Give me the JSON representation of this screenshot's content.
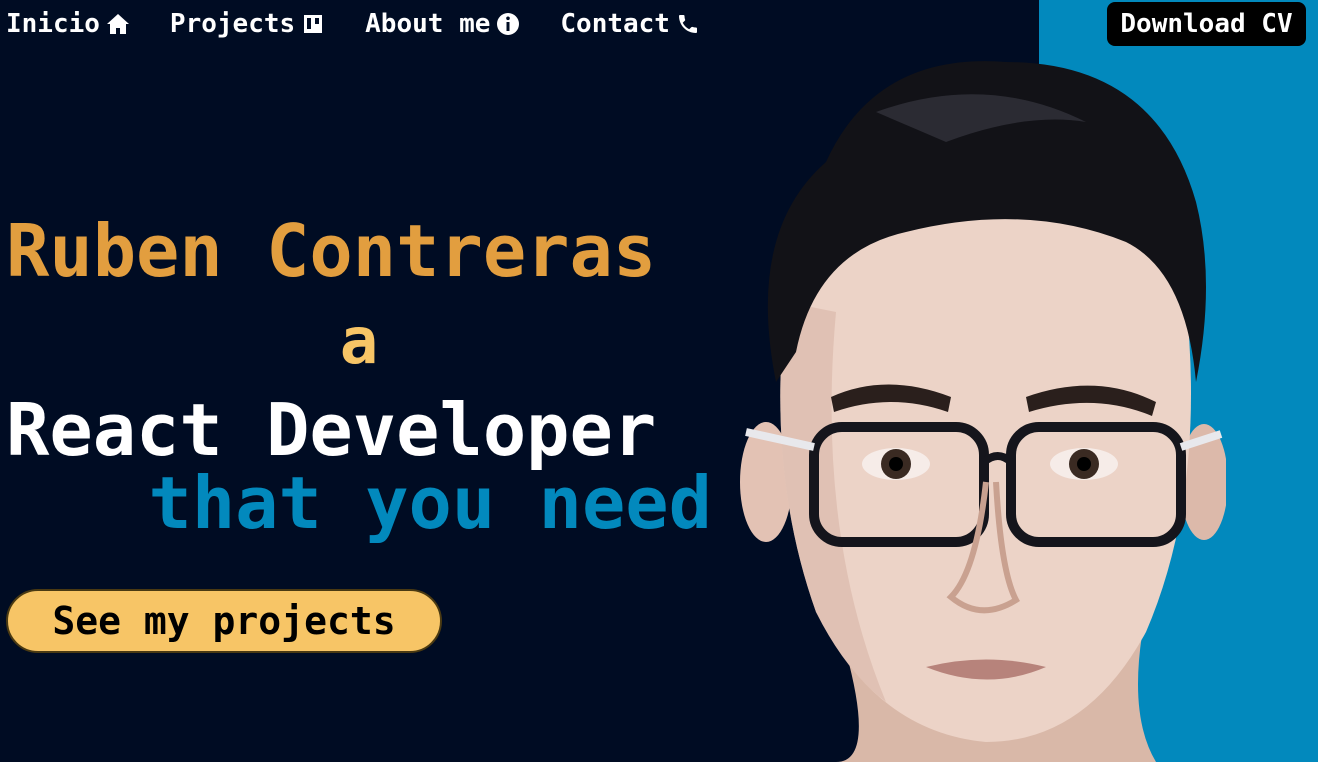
{
  "nav": {
    "items": [
      {
        "label": "Inicio",
        "icon": "home-icon"
      },
      {
        "label": "Projects",
        "icon": "trello-icon"
      },
      {
        "label": "About me",
        "icon": "info-icon"
      },
      {
        "label": "Contact",
        "icon": "phone-icon"
      }
    ],
    "download_label": "Download CV"
  },
  "hero": {
    "name": "Ruben Contreras",
    "article": "a",
    "role": "React Developer",
    "tagline": "that you need",
    "cta_label": "See my projects"
  },
  "colors": {
    "background": "#000c23",
    "accent_blue": "#0289bd",
    "name_orange": "#e29e3f",
    "cta_yellow": "#f7c566"
  }
}
